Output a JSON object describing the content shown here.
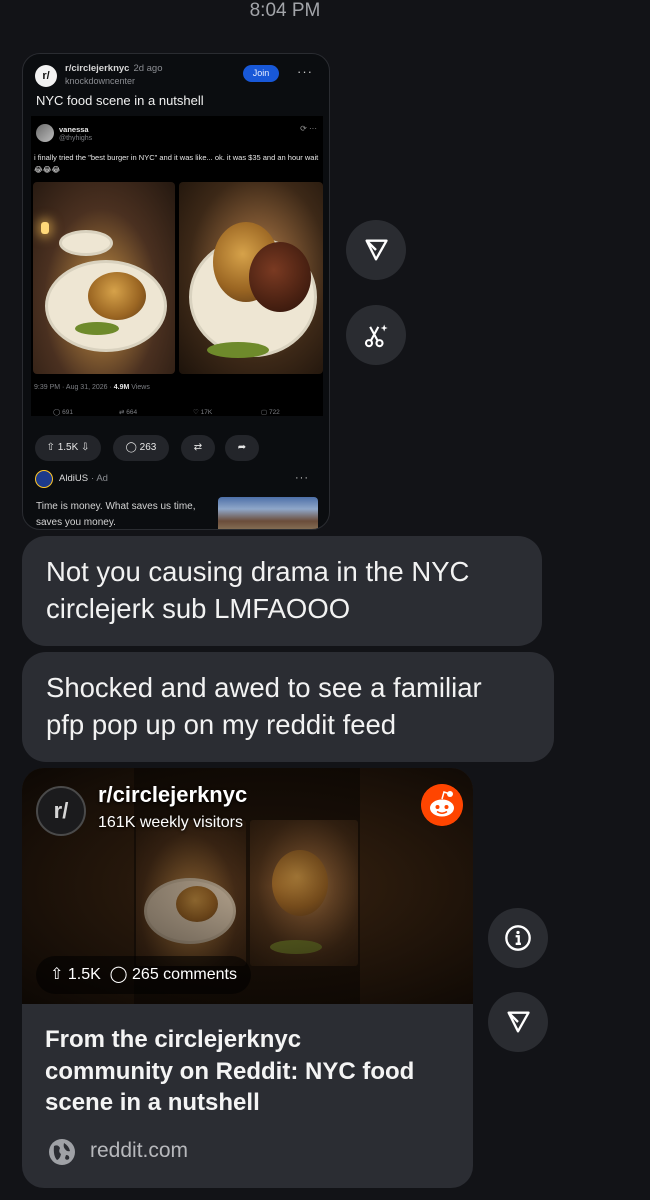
{
  "status_time": "8:04 PM",
  "shared_post": {
    "subreddit": "r/circlejerknyc",
    "age": "2d ago",
    "author": "knockdowncenter",
    "join_label": "Join",
    "title": "NYC food scene in a nutshell",
    "tweet": {
      "name": "vanessa",
      "handle": "@thyhighs",
      "text": "i finally tried the \"best burger in NYC\" and it was like... ok. it was $35 and an hour wait 😂😂😂",
      "timestamp": "9:39 PM · Aug 31, 2026 ·",
      "views_count": "4.9M",
      "views_label": "Views",
      "replies": "691",
      "reposts": "664",
      "likes": "17K",
      "bookmarks": "722"
    },
    "score": "1.5K",
    "comments": "263",
    "ad": {
      "name": "AldiUS",
      "tag": "· Ad",
      "text": "Time is money. What saves us time, saves you money."
    }
  },
  "messages": [
    {
      "lines": [
        "Not you causing drama in the NYC",
        "circlejerk sub LMFAOOO"
      ]
    },
    {
      "lines": [
        "Shocked and awed to see a familiar",
        "pfp pop up on my reddit feed"
      ]
    }
  ],
  "link_preview": {
    "logo_text": "r/",
    "subreddit": "r/circlejerknyc",
    "visitors": "161K weekly visitors",
    "score": "1.5K",
    "comments": "265 comments",
    "title_lines": [
      "From the circlejerknyc",
      "community on Reddit: NYC food",
      "scene in a nutshell"
    ],
    "domain": "reddit.com"
  },
  "colors": {
    "background": "#121317",
    "bubble": "#2b2d33",
    "join_blue": "#1858d8",
    "reddit_orange": "#ff4500"
  },
  "icons": [
    "send-icon",
    "scissors-sparkle-icon",
    "info-icon",
    "globe-icon",
    "reddit-snoo-icon",
    "upvote-icon",
    "downvote-icon",
    "comment-icon",
    "share-icon",
    "repost-icon"
  ]
}
